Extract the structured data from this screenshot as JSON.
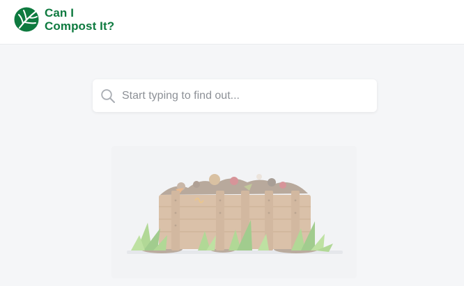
{
  "header": {
    "brand": {
      "line1": "Can I",
      "line2": "Compost It?",
      "logo_icon": "leaf-logo-icon"
    }
  },
  "search": {
    "placeholder": "Start typing to find out...",
    "value": "",
    "icon": "search-icon"
  },
  "illustration": {
    "subject": "compost-bin-illustration"
  },
  "colors": {
    "brand_green": "#0e7a3f",
    "page_bg": "#f5f6f8",
    "header_bg": "#ffffff",
    "placeholder_text": "#8c9096"
  }
}
